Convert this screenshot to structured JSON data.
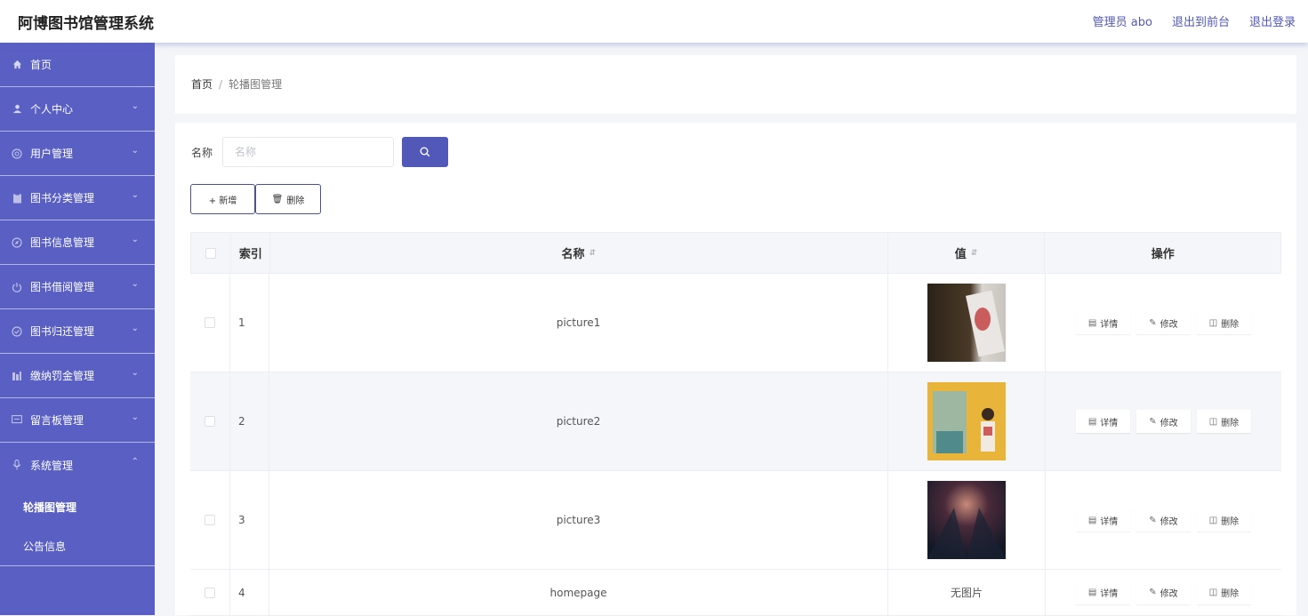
{
  "app": {
    "title": "阿博图书馆管理系统"
  },
  "header": {
    "user": "管理员 abo",
    "to_front": "退出到前台",
    "logout": "退出登录"
  },
  "sidebar": {
    "items": [
      {
        "label": "首页",
        "icon": "home-icon"
      },
      {
        "label": "个人中心",
        "icon": "user-icon"
      },
      {
        "label": "用户管理",
        "icon": "users-icon"
      },
      {
        "label": "图书分类管理",
        "icon": "clipboard-icon"
      },
      {
        "label": "图书信息管理",
        "icon": "compass-icon"
      },
      {
        "label": "图书借阅管理",
        "icon": "power-icon"
      },
      {
        "label": "图书归还管理",
        "icon": "check-circle-icon"
      },
      {
        "label": "缴纳罚金管理",
        "icon": "bar-chart-icon"
      },
      {
        "label": "留言板管理",
        "icon": "message-icon"
      },
      {
        "label": "系统管理",
        "icon": "microphone-icon"
      }
    ],
    "submenu": [
      {
        "label": "轮播图管理"
      },
      {
        "label": "公告信息"
      }
    ]
  },
  "breadcrumb": {
    "home": "首页",
    "separator": "/",
    "current": "轮播图管理"
  },
  "search": {
    "label": "名称",
    "placeholder": "名称"
  },
  "toolbar": {
    "add_label": "+ 新增",
    "delete_label": "删除"
  },
  "table": {
    "headers": {
      "index": "索引",
      "name": "名称",
      "value": "值",
      "ops": "操作"
    },
    "rows": [
      {
        "index": "1",
        "name": "picture1",
        "value": ""
      },
      {
        "index": "2",
        "name": "picture2",
        "value": ""
      },
      {
        "index": "3",
        "name": "picture3",
        "value": ""
      },
      {
        "index": "4",
        "name": "homepage",
        "value": "无图片"
      }
    ],
    "actions": {
      "detail": "详情",
      "edit": "修改",
      "delete": "删除"
    }
  },
  "colors": {
    "accent": "#5a5fc4",
    "button": "#5158b7"
  }
}
